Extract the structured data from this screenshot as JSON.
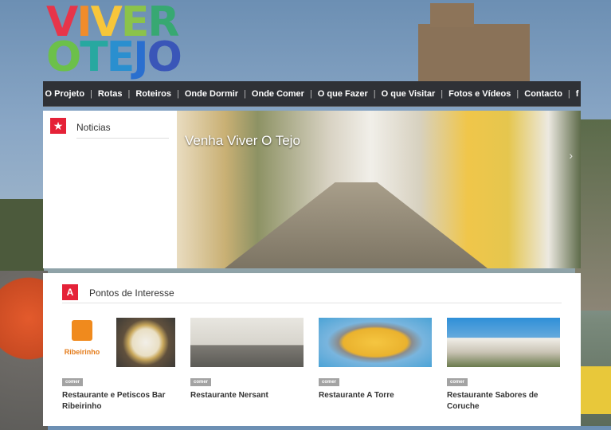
{
  "logo": {
    "line1": [
      "V",
      "I",
      "V",
      "E",
      "R"
    ],
    "line2": [
      "O",
      " ",
      "T",
      "E",
      "J",
      "O"
    ]
  },
  "nav": {
    "items": [
      "O Projeto",
      "Rotas",
      "Roteiros",
      "Onde Dormir",
      "Onde Comer",
      "O que Fazer",
      "O que Visitar",
      "Fotos e Vídeos",
      "Contacto",
      "f"
    ],
    "separator": "|"
  },
  "sidebar": {
    "title": "Noticias",
    "icon": "star-icon",
    "icon_glyph": "★"
  },
  "slider": {
    "title": "Venha Viver O Tejo",
    "prev_glyph": "‹",
    "next_glyph": "›"
  },
  "points": {
    "title": "Pontos de Interesse",
    "icon": "road-icon",
    "icon_glyph": "A",
    "cards": [
      {
        "badge": "comer",
        "title": "Restaurante e Petiscos Bar Ribeirinho",
        "thumb_label": "Ribeirinho"
      },
      {
        "badge": "comer",
        "title": "Restaurante Nersant",
        "thumb_label": ""
      },
      {
        "badge": "comer",
        "title": "Restaurante A Torre",
        "thumb_label": ""
      },
      {
        "badge": "comer",
        "title": "Restaurante Sabores de Coruche",
        "thumb_label": ""
      }
    ]
  },
  "colors": {
    "accent": "#e52238",
    "nav_bg": "#2f3136",
    "badge": "#a3a3a3"
  }
}
